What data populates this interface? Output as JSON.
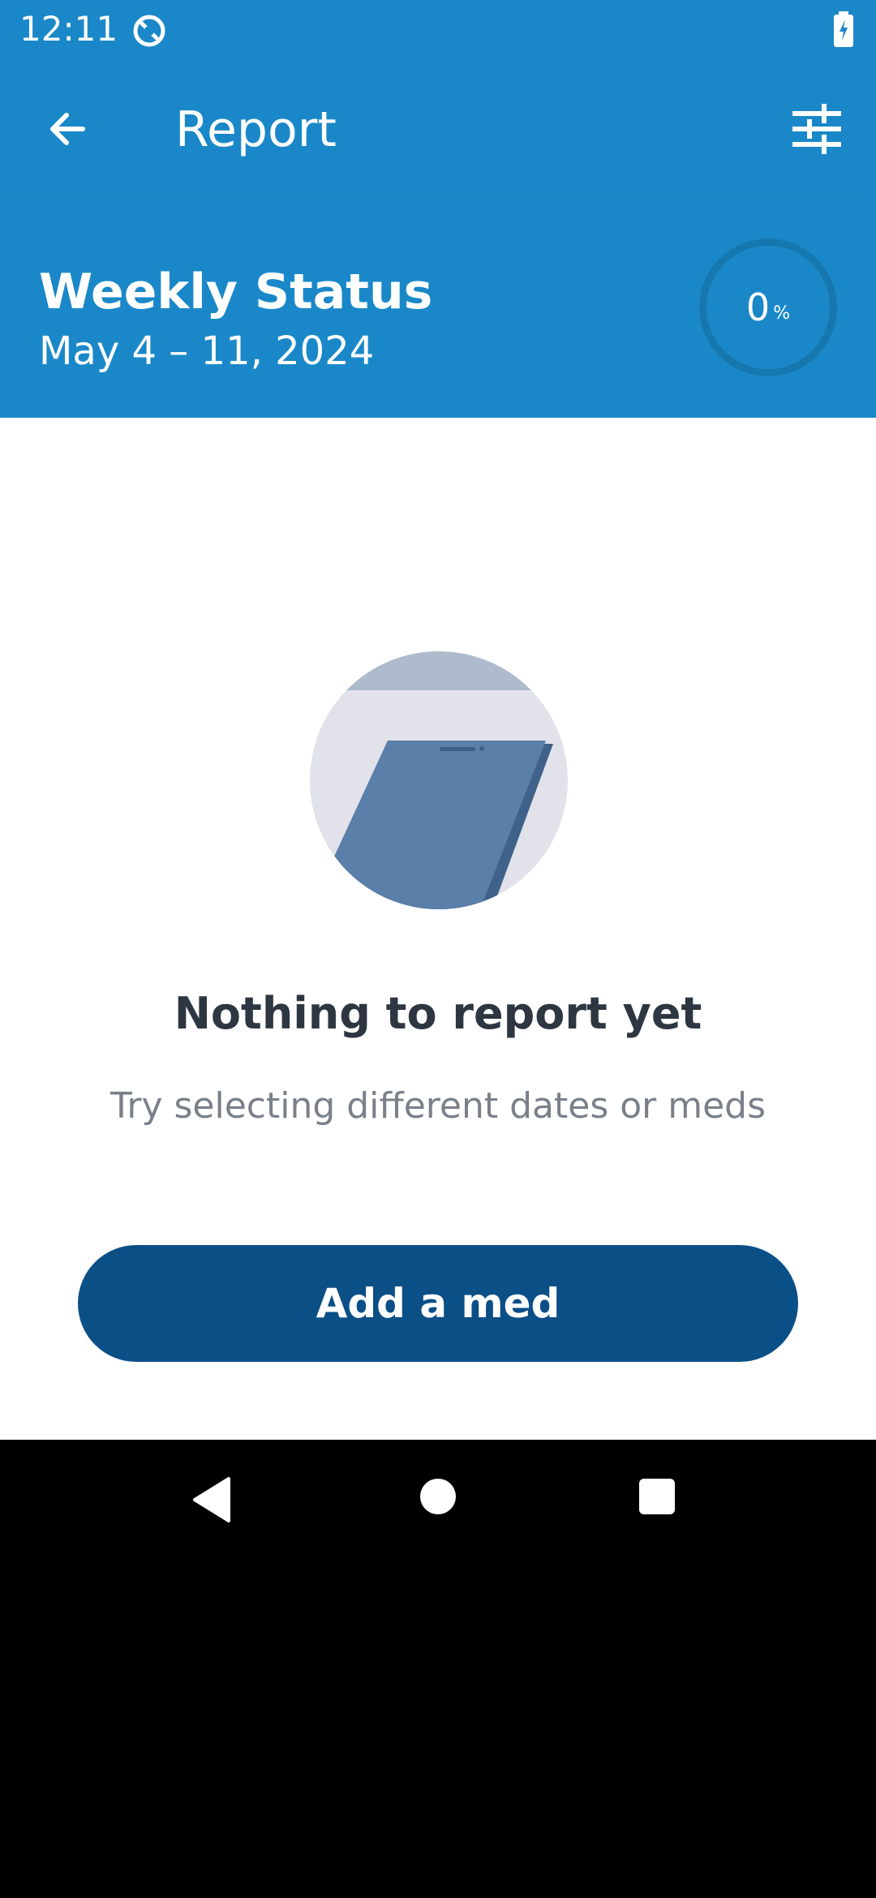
{
  "status_bar": {
    "time": "12:11",
    "app_icon": "rotate-sync-icon",
    "battery_icon": "battery-charging-icon"
  },
  "toolbar": {
    "title": "Report",
    "back_icon": "arrow-left-icon",
    "filter_icon": "tune-sliders-icon"
  },
  "weekly_status": {
    "title": "Weekly Status",
    "date_range": "May 4 – 11, 2024",
    "progress_value": "0",
    "progress_unit": "%"
  },
  "empty_state": {
    "illustration": "phone-illustration",
    "title": "Nothing to report yet",
    "subtitle": "Try selecting different dates or meds"
  },
  "actions": {
    "add_med_label": "Add a med"
  },
  "colors": {
    "primary": "#1a88c8",
    "button": "#0b4f87",
    "title_text": "#2e3642",
    "subtitle_text": "#7a808a"
  }
}
